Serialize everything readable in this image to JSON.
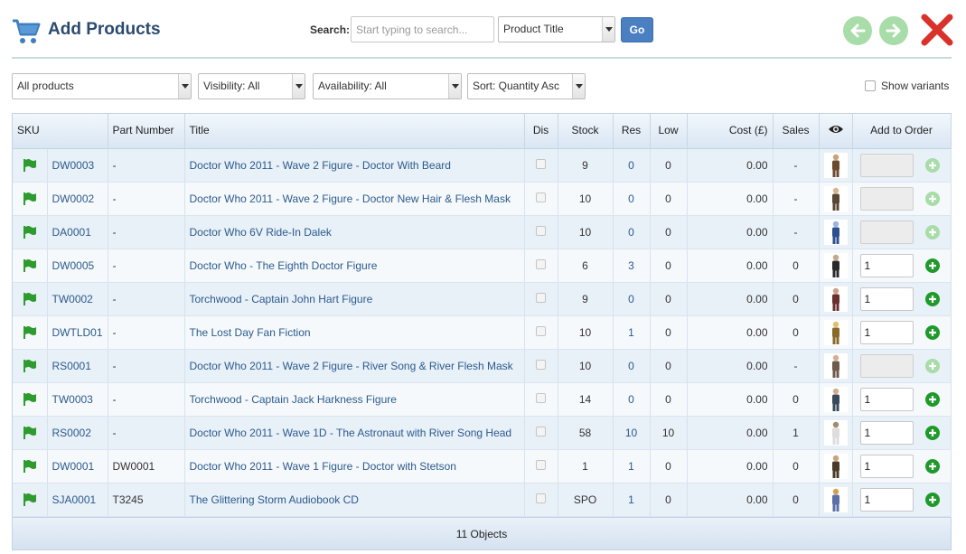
{
  "header": {
    "title": "Add Products",
    "search_label": "Search:",
    "search_placeholder": "Start typing to search...",
    "search_field_select": "Product Title",
    "go_label": "Go"
  },
  "filters": {
    "products": "All products",
    "visibility": "Visibility: All",
    "availability": "Availability: All",
    "sort": "Sort: Quantity Asc",
    "show_variants": "Show variants"
  },
  "columns": [
    "SKU",
    "Part Number",
    "Title",
    "Dis",
    "Stock",
    "Res",
    "Low",
    "Cost (£)",
    "Sales",
    "Add to Order"
  ],
  "rows": [
    {
      "sku": "DW0003",
      "part": "-",
      "title": "Doctor Who 2011 - Wave 2 Figure - Doctor With Beard",
      "stock": "9",
      "res": "0",
      "low": "0",
      "cost": "0.00",
      "sales": "-",
      "qty": "",
      "enabled": false
    },
    {
      "sku": "DW0002",
      "part": "-",
      "title": "Doctor Who 2011 - Wave 2 Figure - Doctor New Hair & Flesh Mask",
      "stock": "10",
      "res": "0",
      "low": "0",
      "cost": "0.00",
      "sales": "-",
      "qty": "",
      "enabled": false
    },
    {
      "sku": "DA0001",
      "part": "-",
      "title": "Doctor Who 6V Ride-In Dalek",
      "stock": "10",
      "res": "0",
      "low": "0",
      "cost": "0.00",
      "sales": "-",
      "qty": "",
      "enabled": false
    },
    {
      "sku": "DW0005",
      "part": "-",
      "title": "Doctor Who - The Eighth Doctor Figure",
      "stock": "6",
      "res": "3",
      "low": "0",
      "cost": "0.00",
      "sales": "0",
      "qty": "1",
      "enabled": true
    },
    {
      "sku": "TW0002",
      "part": "-",
      "title": "Torchwood - Captain John Hart Figure",
      "stock": "9",
      "res": "0",
      "low": "0",
      "cost": "0.00",
      "sales": "0",
      "qty": "1",
      "enabled": true
    },
    {
      "sku": "DWTLD01",
      "part": "-",
      "title": "The Lost Day Fan Fiction",
      "stock": "10",
      "res": "1",
      "low": "0",
      "cost": "0.00",
      "sales": "0",
      "qty": "1",
      "enabled": true
    },
    {
      "sku": "RS0001",
      "part": "-",
      "title": "Doctor Who 2011 - Wave 2 Figure - River Song & River Flesh Mask",
      "stock": "10",
      "res": "0",
      "low": "0",
      "cost": "0.00",
      "sales": "-",
      "qty": "",
      "enabled": false
    },
    {
      "sku": "TW0003",
      "part": "-",
      "title": "Torchwood - Captain Jack Harkness Figure",
      "stock": "14",
      "res": "0",
      "low": "0",
      "cost": "0.00",
      "sales": "0",
      "qty": "1",
      "enabled": true
    },
    {
      "sku": "RS0002",
      "part": "-",
      "title": "Doctor Who 2011 - Wave 1D - The Astronaut with River Song Head",
      "stock": "58",
      "res": "10",
      "low": "10",
      "cost": "0.00",
      "sales": "1",
      "qty": "1",
      "enabled": true
    },
    {
      "sku": "DW0001",
      "part": "DW0001",
      "title": "Doctor Who 2011 - Wave 1 Figure - Doctor with Stetson",
      "stock": "1",
      "res": "1",
      "low": "0",
      "cost": "0.00",
      "sales": "0",
      "qty": "1",
      "enabled": true
    },
    {
      "sku": "SJA0001",
      "part": "T3245",
      "title": "The Glittering Storm Audiobook CD",
      "stock": "SPO",
      "res": "1",
      "low": "0",
      "cost": "0.00",
      "sales": "0",
      "qty": "1",
      "enabled": true
    }
  ],
  "footer": {
    "count": "11 Objects"
  },
  "colors": {
    "accent": "#4a7fc1",
    "title": "#2c4a70",
    "link": "#2c5a8c",
    "flag": "#2e9b2e",
    "close": "#d9312b",
    "add_enabled": "#1f9a2a",
    "add_disabled": "#a8dca8"
  },
  "icons": {
    "cart": "shopping-cart-icon",
    "back": "arrow-left-icon",
    "forward": "arrow-right-icon",
    "close": "close-icon",
    "eye": "eye-icon",
    "flag": "flag-icon",
    "add": "plus-circle-icon"
  }
}
